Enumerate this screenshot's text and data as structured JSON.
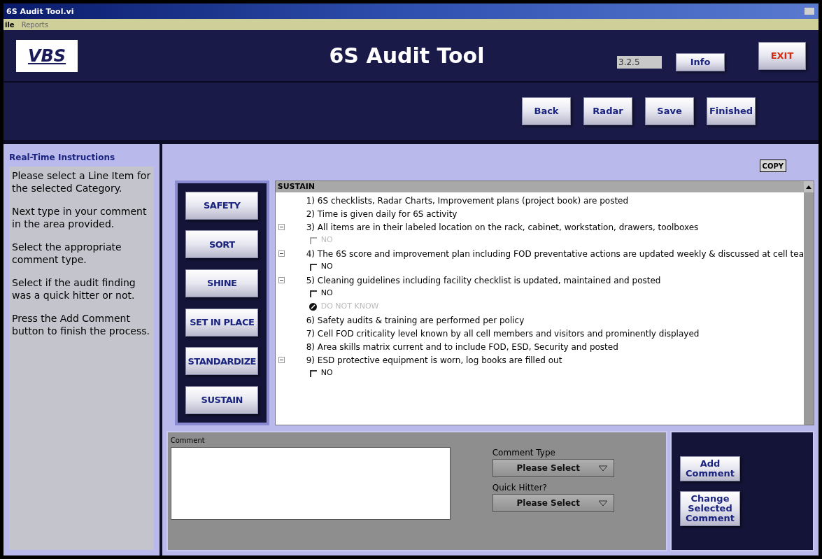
{
  "window": {
    "title": "6S Audit Tool.vi"
  },
  "menu": [
    "ile",
    "Reports"
  ],
  "header": {
    "logo": "VBS",
    "title": "6S Audit Tool",
    "version": "3.2.5",
    "info_button": "Info",
    "exit_button": "EXIT"
  },
  "toolbar": [
    "Back",
    "Radar",
    "Save",
    "Finished"
  ],
  "instructions": {
    "title": "Real-Time Instructions",
    "paragraphs": [
      "Please select a Line Item for the selected Category.",
      "Next type in your comment in the area provided.",
      "Select the appropriate comment type.",
      "Select if the audit finding was a quick hitter or not.",
      "Press the Add Comment button to finish the process."
    ]
  },
  "copy_button": "COPY",
  "categories": [
    "SAFETY",
    "SORT",
    "SHINE",
    "SET IN PLACE",
    "STANDARDIZE",
    "SUSTAIN"
  ],
  "tree": {
    "header": "SUSTAIN",
    "items": [
      {
        "kind": "item",
        "text": "1) 6S checklists, Radar Charts, Improvement plans (project book) are posted"
      },
      {
        "kind": "item",
        "text": "2) Time is given daily for 6S activity"
      },
      {
        "kind": "item",
        "text": "3) All items are in their labeled location on the rack, cabinet, workstation, drawers, toolboxes",
        "expanded": true,
        "children": [
          {
            "kind": "checkbox",
            "label": "NO",
            "checked": false,
            "disabled": true
          }
        ]
      },
      {
        "kind": "item",
        "text": "4) The 6S score and improvement plan including FOD preventative actions are updated weekly & discussed at cell tea",
        "expanded": true,
        "children": [
          {
            "kind": "checkbox",
            "label": "NO",
            "checked": false,
            "disabled": false
          }
        ]
      },
      {
        "kind": "item",
        "text": "5) Cleaning guidelines including facility checklist is updated, maintained and posted",
        "expanded": true,
        "children": [
          {
            "kind": "checkbox",
            "label": "NO",
            "checked": false,
            "disabled": false
          },
          {
            "kind": "unknown",
            "label": "DO NOT KNOW",
            "disabled": true
          }
        ]
      },
      {
        "kind": "item",
        "text": "6) Safety audits & training are performed per policy"
      },
      {
        "kind": "item",
        "text": "7) Cell FOD criticality level known by all cell members and visitors and prominently displayed"
      },
      {
        "kind": "item",
        "text": "8) Area skills matrix current and to include FOD, ESD, Security and posted"
      },
      {
        "kind": "item",
        "text": "9) ESD protective equipment is worn, log books are filled out",
        "expanded": true,
        "children": [
          {
            "kind": "checkbox",
            "label": "NO",
            "checked": false,
            "disabled": false
          }
        ]
      }
    ]
  },
  "comment": {
    "label": "Comment"
  },
  "comment_type": {
    "label": "Comment Type",
    "value": "Please Select"
  },
  "quick_hitter": {
    "label": "Quick Hitter?",
    "value": "Please Select"
  },
  "actions": [
    "Add Comment",
    "Change Selected Comment"
  ]
}
